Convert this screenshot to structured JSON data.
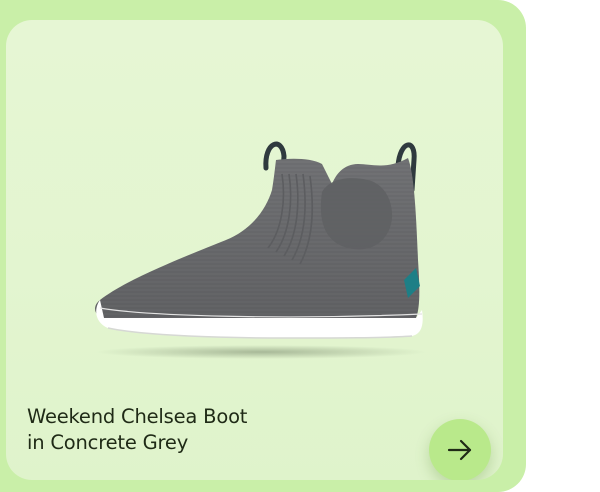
{
  "product": {
    "title_line1": "Weekend Chelsea Boot",
    "title_line2": "in Concrete Grey",
    "image_alt": "Weekend Chelsea Boot in Concrete Grey"
  },
  "icons": {
    "view_product": "arrow-right-icon"
  },
  "colors": {
    "card_background": "#e3f5d0",
    "card_border": "#c9efa8",
    "button_background": "#b9e98b",
    "boot_knit": "#76777a",
    "boot_sole": "#ffffff",
    "accent_tab": "#1d7f86",
    "title_text": "#1f2a16"
  }
}
